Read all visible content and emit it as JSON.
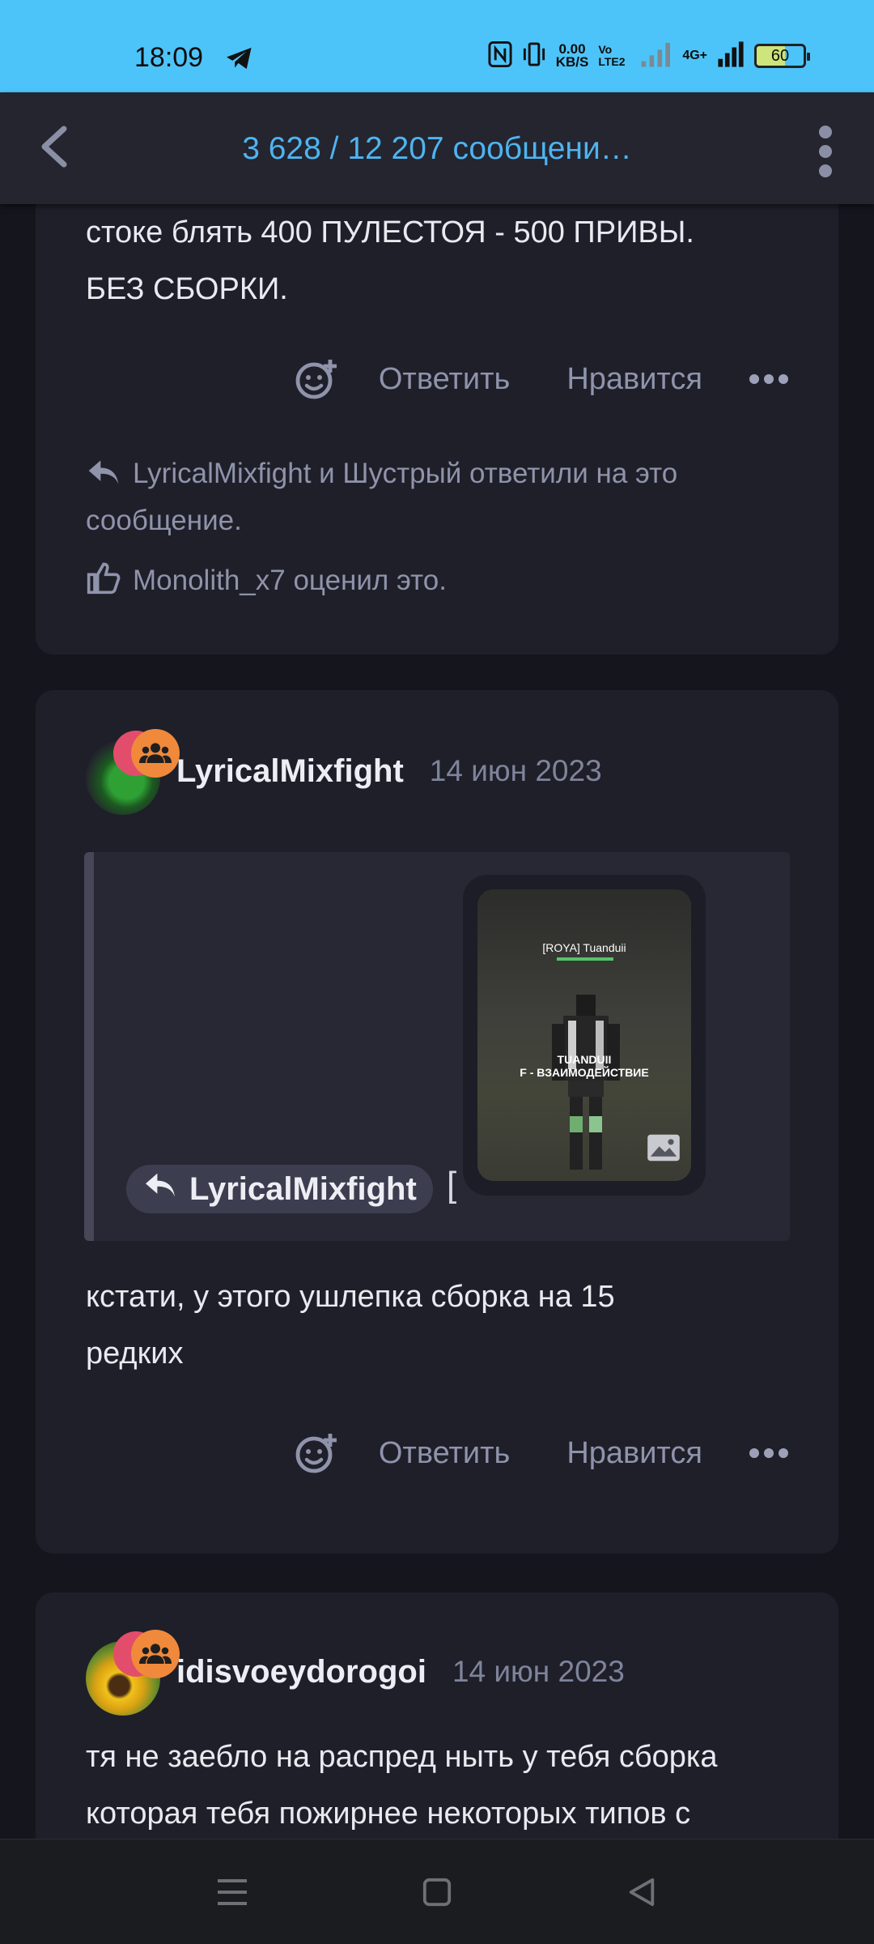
{
  "status_bar": {
    "time": "18:09",
    "speed_top": "0.00",
    "speed_bottom": "KB/S",
    "volte": "Vo LTE2",
    "network": "4G+",
    "battery": "60"
  },
  "header": {
    "title": "3 628 / 12 207 сообщени…"
  },
  "post1": {
    "text_line1": "стоке блять 400 ПУЛЕСТОЯ - 500 ПРИВЫ.",
    "text_line2": "БЕЗ СБОРКИ.",
    "reply_label": "Ответить",
    "like_label": "Нравится",
    "replied_line1": "LyricalMixfight и Шустрый ответили на это",
    "replied_line2": "сообщение.",
    "liked_text": "Monolith_x7 оценил это."
  },
  "post2": {
    "username": "LyricalMixfight",
    "date": "14 июн 2023",
    "quote_author": "LyricalMixfight",
    "quote_bracket": "[",
    "game_player_name": "[ROYA] Tuanduii",
    "game_label_line1": "TUANDUII",
    "game_label_line2": "F - ВЗАИМОДЕЙСТВИЕ",
    "text_line1": "кстати, у этого ушлепка сборка на 15",
    "text_line2": "редких",
    "reply_label": "Ответить",
    "like_label": "Нравится"
  },
  "post3": {
    "username": "idisvoeydorogoi",
    "date": "14 июн 2023",
    "text_line1": "тя не заебло на распред ныть у тебя сборка",
    "text_line2": "которая тебя пожирнее некоторых типов с"
  },
  "colors": {
    "status_bar_bg": "#4dc4f9",
    "accent": "#4eb4f0",
    "card_bg": "#1e1f28",
    "badge_orange": "#f0893b",
    "badge_pink": "#e34d6c"
  },
  "icons": [
    "telegram-icon",
    "nfc-icon",
    "vibrate-icon",
    "signal-icon",
    "battery-icon",
    "back-arrow-icon",
    "more-vertical-icon",
    "add-reaction-icon",
    "more-horizontal-icon",
    "reply-icon",
    "thumbs-up-icon",
    "group-icon",
    "image-icon",
    "menu-icon",
    "home-icon",
    "back-triangle-icon"
  ]
}
